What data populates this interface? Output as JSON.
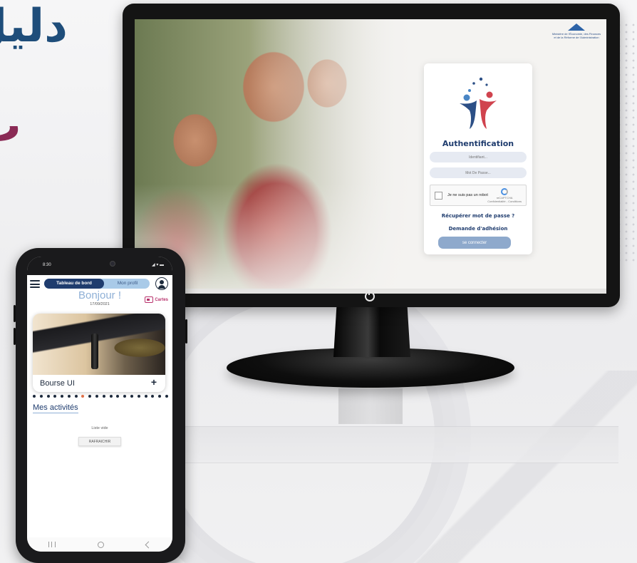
{
  "background": {
    "arabic_title_line1": "دليل",
    "arabic_title_line2": "ب"
  },
  "desktop": {
    "ministry_caption": "Ministère de l'Économie, des Finances et de la Réforme de l'Administration",
    "auth": {
      "title": "Authentification",
      "username_placeholder": "Identifiant...",
      "password_placeholder": "Mot De Passe...",
      "captcha_label": "Je ne suis pas un robot",
      "captcha_brand": "reCAPTCHA",
      "captcha_sub": "Confidentialité - Conditions",
      "forgot_link": "Récupérer mot de passe ?",
      "membership_link": "Demande d'adhésion",
      "login_button": "se connecter"
    }
  },
  "mobile": {
    "status_time": "8:30",
    "status_icons": "◢ ▾ ▬",
    "tabs": [
      {
        "label": "Tableau de bord",
        "active": true
      },
      {
        "label": "Mon profil",
        "active": false
      }
    ],
    "greeting": "Bonjour !",
    "date": "17/09/2021",
    "cards_label": "Cartes",
    "card_title": "Bourse UI",
    "card_action": "+",
    "carousel_active_index": 7,
    "carousel_count": 20,
    "activities_title": "Mes activités",
    "empty_list": "Liste vide",
    "refresh_button": "RAFRAICHIR"
  },
  "colors": {
    "primary": "#1f3c6e",
    "accent_blue": "#a9cae8",
    "accent_pink": "#b8326c",
    "accent_orange": "#e07048"
  }
}
